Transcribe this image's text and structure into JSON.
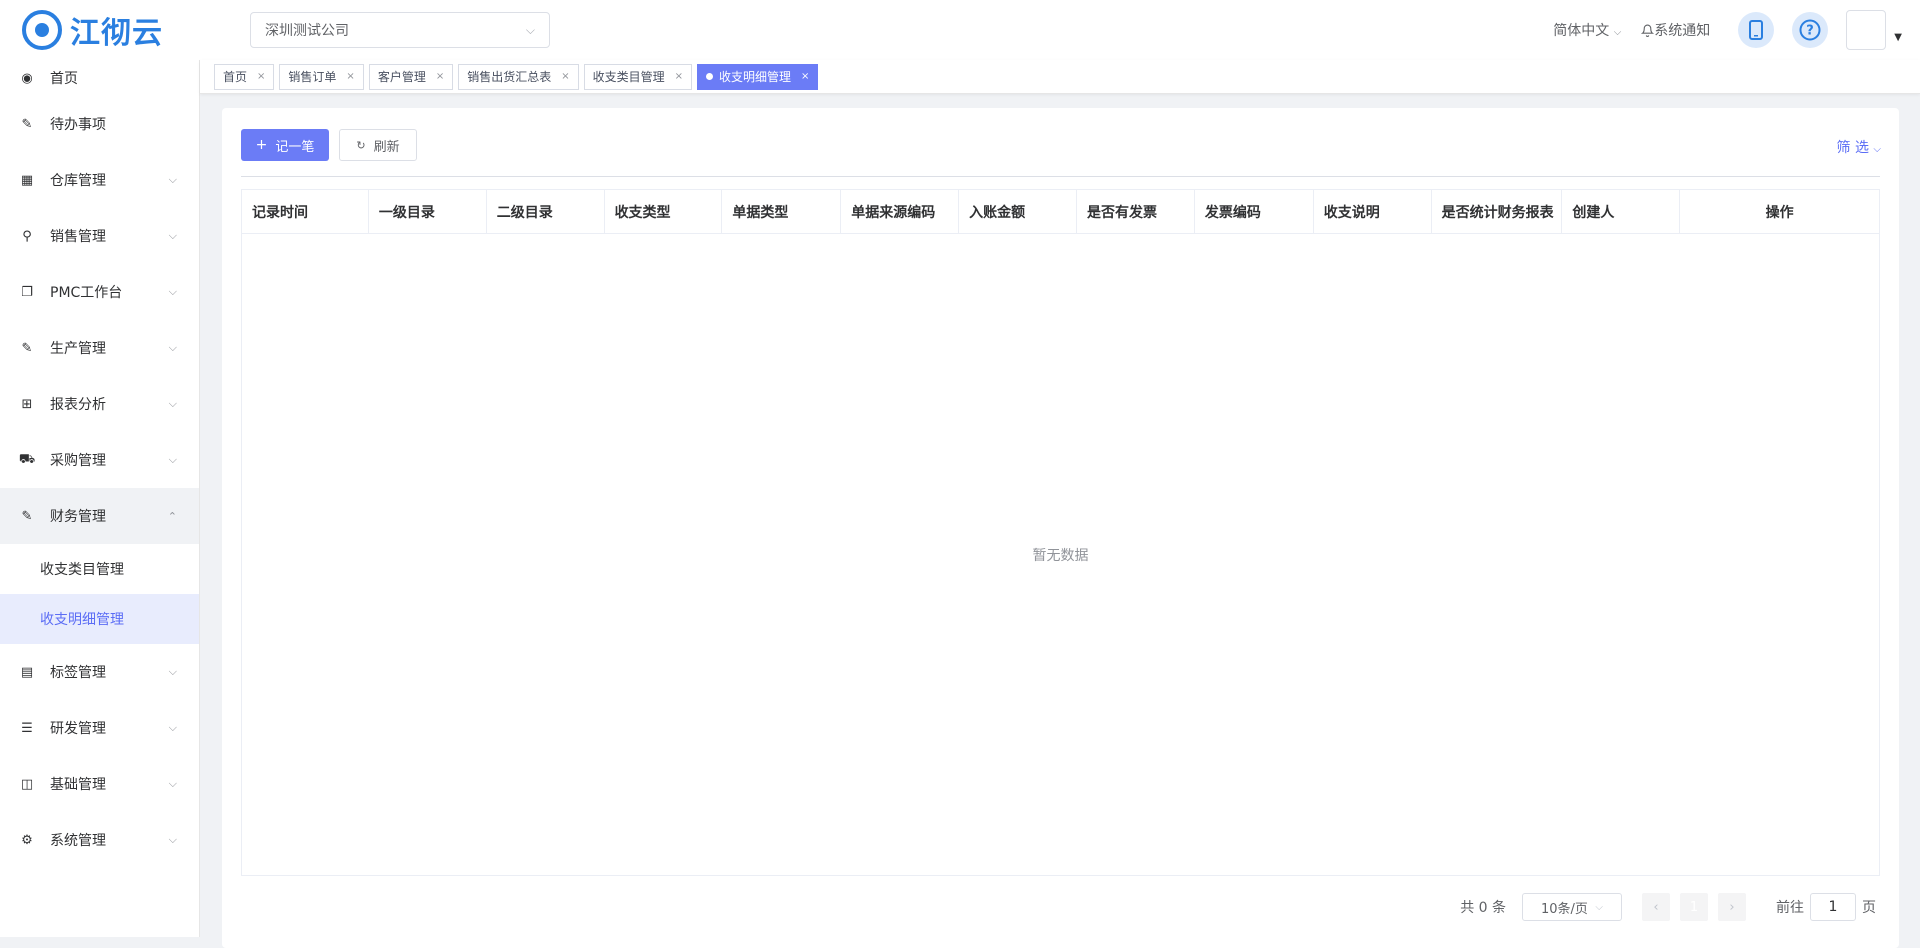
{
  "header": {
    "logo_text": "江彻云",
    "company": "深圳测试公司",
    "language": "简体中文",
    "notice": "系统通知"
  },
  "sidebar": {
    "items": [
      {
        "label": "首页",
        "icon": "dashboard-icon"
      },
      {
        "label": "待办事项",
        "icon": "edit-icon"
      },
      {
        "label": "仓库管理",
        "icon": "table-icon"
      },
      {
        "label": "销售管理",
        "icon": "person-icon"
      },
      {
        "label": "PMC工作台",
        "icon": "copy-icon"
      },
      {
        "label": "生产管理",
        "icon": "edit-icon"
      },
      {
        "label": "报表分析",
        "icon": "grid-icon"
      },
      {
        "label": "采购管理",
        "icon": "cart-icon"
      },
      {
        "label": "财务管理",
        "icon": "edit-doc-icon"
      },
      {
        "label": "标签管理",
        "icon": "tag-icon"
      },
      {
        "label": "研发管理",
        "icon": "sliders-icon"
      },
      {
        "label": "基础管理",
        "icon": "book-icon"
      },
      {
        "label": "系统管理",
        "icon": "gear-icon"
      }
    ],
    "finance_sub": [
      "收支类目管理",
      "收支明细管理"
    ]
  },
  "tabs": [
    {
      "label": "首页"
    },
    {
      "label": "销售订单"
    },
    {
      "label": "客户管理"
    },
    {
      "label": "销售出货汇总表"
    },
    {
      "label": "收支类目管理"
    },
    {
      "label": "收支明细管理"
    }
  ],
  "toolbar": {
    "add_label": "记一笔",
    "refresh_label": "刷新",
    "filter_label": "筛 选"
  },
  "table": {
    "columns": [
      "记录时间",
      "一级目录",
      "二级目录",
      "收支类型",
      "单据类型",
      "单据来源编码",
      "入账金额",
      "是否有发票",
      "发票编码",
      "收支说明",
      "是否统计财务报表",
      "创建人",
      "操作"
    ],
    "empty_text": "暂无数据"
  },
  "pagination": {
    "total": "共 0 条",
    "page_size": "10条/页",
    "current_page": "1",
    "goto_label": "前往",
    "goto_value": "1",
    "page_suffix": "页"
  },
  "colors": {
    "primary": "#6b7cf6",
    "logo": "#2a7fe0"
  }
}
